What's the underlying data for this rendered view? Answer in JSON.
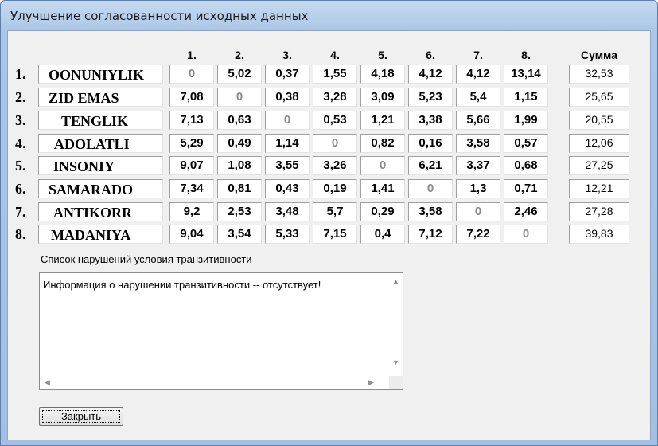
{
  "window": {
    "title": "Улучшение согласованности исходных данных"
  },
  "matrix": {
    "column_headers": [
      "1.",
      "2.",
      "3.",
      "4.",
      "5.",
      "6.",
      "7.",
      "8."
    ],
    "sum_header": "Сумма",
    "rows": [
      {
        "num": "1.",
        "name": "OONUNIYLIK",
        "values": [
          "0",
          "5,02",
          "0,37",
          "1,55",
          "4,18",
          "4,12",
          "4,12",
          "13,14"
        ],
        "sum": "32,53"
      },
      {
        "num": "2.",
        "name": "ZID EMAS",
        "values": [
          "7,08",
          "0",
          "0,38",
          "3,28",
          "3,09",
          "5,23",
          "5,4",
          "1,15"
        ],
        "sum": "25,65"
      },
      {
        "num": "3.",
        "name": "TENGLIK",
        "values": [
          "7,13",
          "0,63",
          "0",
          "0,53",
          "1,21",
          "3,38",
          "5,66",
          "1,99"
        ],
        "sum": "20,55"
      },
      {
        "num": "4.",
        "name": "ADOLATLI",
        "values": [
          "5,29",
          "0,49",
          "1,14",
          "0",
          "0,82",
          "0,16",
          "3,58",
          "0,57"
        ],
        "sum": "12,06"
      },
      {
        "num": "5.",
        "name": "INSONIY",
        "values": [
          "9,07",
          "1,08",
          "3,55",
          "3,26",
          "0",
          "6,21",
          "3,37",
          "0,68"
        ],
        "sum": "27,25"
      },
      {
        "num": "6.",
        "name": "SAMARADO",
        "values": [
          "7,34",
          "0,81",
          "0,43",
          "0,19",
          "1,41",
          "0",
          "1,3",
          "0,71"
        ],
        "sum": "12,21"
      },
      {
        "num": "7.",
        "name": "ANTIKORR",
        "values": [
          "9,2",
          "2,53",
          "3,48",
          "5,7",
          "0,29",
          "3,58",
          "0",
          "2,46"
        ],
        "sum": "27,28"
      },
      {
        "num": "8.",
        "name": "MADANIYA",
        "values": [
          "9,04",
          "3,54",
          "5,33",
          "7,15",
          "0,4",
          "7,12",
          "7,22",
          "0"
        ],
        "sum": "39,83"
      }
    ]
  },
  "violations": {
    "label": "Список нарушений условия транзитивности",
    "text": "Информация о нарушении транзитивности -- отсутствует!"
  },
  "buttons": {
    "close_label": "Закрыть"
  },
  "colors": {
    "diagonal": "#8a8a8a",
    "title_bar": "#a9c6e6",
    "panel": "#f0f0f0"
  }
}
